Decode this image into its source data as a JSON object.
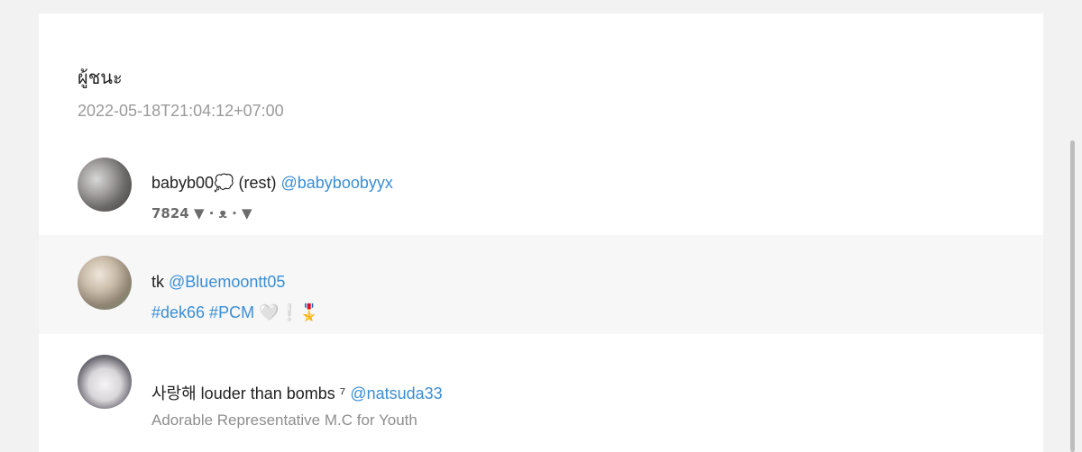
{
  "post": {
    "title": "ผู้ชนะ",
    "timestamp": "2022-05-18T21:04:12+07:00"
  },
  "users": [
    {
      "display_name": "babyb00💭 (rest)",
      "handle": "@babyboobyyx",
      "bio": "7824 ▼ · ᴥ · ▼"
    },
    {
      "display_name": "tk",
      "handle": "@Bluemoontt05",
      "bio": "#dek66 #PCM 🤍❕🎖️"
    },
    {
      "display_name": "사랑해 louder than bombs ⁷",
      "handle": "@natsuda33",
      "bio": "Adorable Representative M.C for Youth"
    }
  ],
  "icons": {
    "avatar": "user-avatar",
    "scrollbar": "vertical-scrollbar"
  }
}
